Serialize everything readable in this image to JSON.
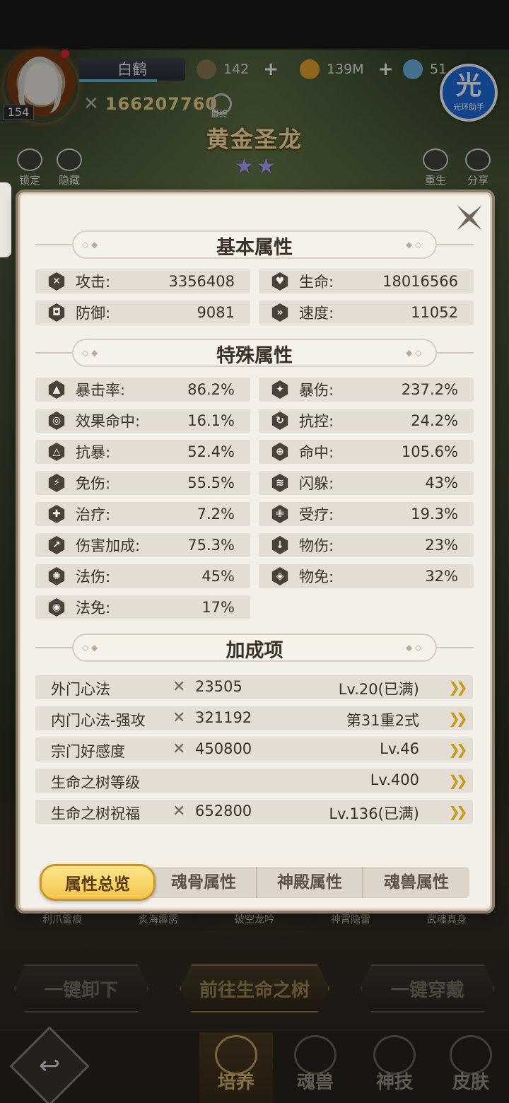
{
  "player": {
    "name": "白鹤",
    "level": "154",
    "power": "166207760",
    "final_label": "最终"
  },
  "currencies": [
    {
      "value": "142",
      "icon": "soul-coin-icon",
      "color": "#8d7a55"
    },
    {
      "value": "139M",
      "icon": "gold-coin-icon",
      "color": "#e5a72b"
    },
    {
      "value": "51",
      "icon": "potion-icon",
      "color": "#6fb3e6"
    }
  ],
  "hero": {
    "title": "黄金圣龙",
    "stars": [
      "★",
      "★"
    ]
  },
  "side_buttons": {
    "lock": "锁定",
    "hide": "隐藏",
    "reborn": "重生",
    "share": "分享"
  },
  "helper_badge": {
    "glyph": "光",
    "label": "光环助手"
  },
  "sections": {
    "basic": "基本属性",
    "special": "特殊属性",
    "bonus": "加成项"
  },
  "basic_stats": [
    {
      "label": "攻击:",
      "value": "3356408",
      "icon": "attack-icon"
    },
    {
      "label": "生命:",
      "value": "18016566",
      "icon": "health-icon"
    },
    {
      "label": "防御:",
      "value": "9081",
      "icon": "defense-icon"
    },
    {
      "label": "速度:",
      "value": "11052",
      "icon": "speed-icon"
    }
  ],
  "special_stats": [
    {
      "label": "暴击率:",
      "value": "86.2%",
      "icon": "crit-rate-icon"
    },
    {
      "label": "暴伤:",
      "value": "237.2%",
      "icon": "crit-damage-icon"
    },
    {
      "label": "效果命中:",
      "value": "16.1%",
      "icon": "effect-hit-icon"
    },
    {
      "label": "抗控:",
      "value": "24.2%",
      "icon": "control-resist-icon"
    },
    {
      "label": "抗暴:",
      "value": "52.4%",
      "icon": "crit-resist-icon"
    },
    {
      "label": "命中:",
      "value": "105.6%",
      "icon": "accuracy-icon"
    },
    {
      "label": "免伤:",
      "value": "55.5%",
      "icon": "damage-reduction-icon"
    },
    {
      "label": "闪躲:",
      "value": "43%",
      "icon": "dodge-icon"
    },
    {
      "label": "治疗:",
      "value": "7.2%",
      "icon": "heal-icon"
    },
    {
      "label": "受疗:",
      "value": "19.3%",
      "icon": "heal-received-icon"
    },
    {
      "label": "伤害加成:",
      "value": "75.3%",
      "icon": "damage-bonus-icon"
    },
    {
      "label": "物伤:",
      "value": "23%",
      "icon": "physical-damage-icon"
    },
    {
      "label": "法伤:",
      "value": "45%",
      "icon": "magic-damage-icon"
    },
    {
      "label": "物免:",
      "value": "32%",
      "icon": "physical-resist-icon"
    },
    {
      "label": "法免:",
      "value": "17%",
      "icon": "magic-resist-icon"
    }
  ],
  "bonus_items": [
    {
      "label": "外门心法",
      "power": "23505",
      "level": "Lv.20(已满)"
    },
    {
      "label": "内门心法-强攻",
      "power": "321192",
      "level": "第31重2式"
    },
    {
      "label": "宗门好感度",
      "power": "450800",
      "level": "Lv.46"
    },
    {
      "label": "生命之树等级",
      "power": "",
      "level": "Lv.400"
    },
    {
      "label": "生命之树祝福",
      "power": "652800",
      "level": "Lv.136(已满)"
    }
  ],
  "tabs": [
    "属性总览",
    "魂骨属性",
    "神殿属性",
    "魂兽属性"
  ],
  "skills": [
    "利爪雷痕",
    "炙海霹雳",
    "破空龙吟",
    "神霄隐雷",
    "武魂真身"
  ],
  "actions": {
    "unequip": "一键卸下",
    "goto_tree": "前往生命之树",
    "equip": "一键穿戴"
  },
  "bottom_nav": [
    "培养",
    "魂兽",
    "神技",
    "皮肤"
  ]
}
